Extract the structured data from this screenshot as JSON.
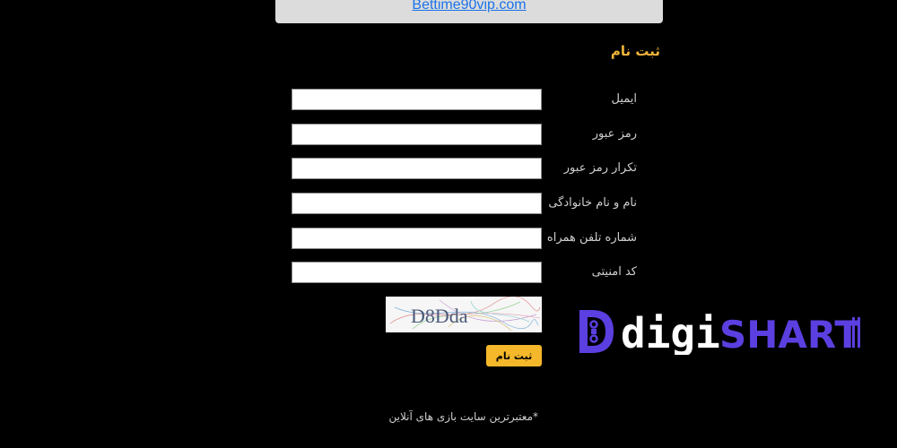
{
  "top_link": {
    "text": "Bettime90vip.com"
  },
  "form": {
    "title": "ثبت نام",
    "fields": [
      {
        "label": "ایمیل",
        "value": ""
      },
      {
        "label": "رمز عبور",
        "value": ""
      },
      {
        "label": "تکرار رمز عبور",
        "value": ""
      },
      {
        "label": "نام و نام خانوادگی",
        "value": ""
      },
      {
        "label": "شماره تلفن همراه",
        "value": ""
      },
      {
        "label": "کد امنیتی",
        "value": ""
      }
    ],
    "captcha_text": "D8Dda",
    "submit_label": "ثبت نام"
  },
  "footer": {
    "text": "*معتبرترین سایت بازی های آنلاین"
  },
  "watermark": {
    "brand_prefix": "digi",
    "brand_suffix": "SHART",
    "color": "#5b3fe0"
  }
}
